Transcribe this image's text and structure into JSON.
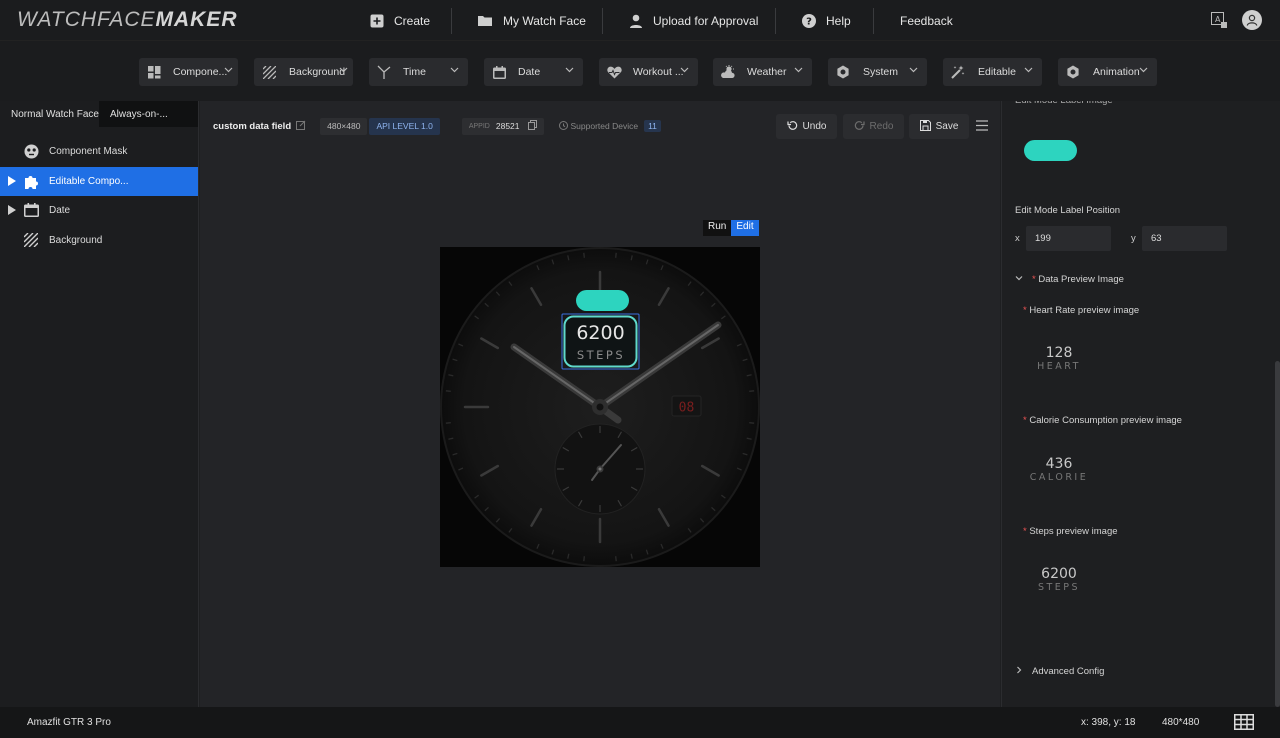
{
  "app": {
    "logo_light": "WATCHFACE",
    "logo_bold": "MAKER"
  },
  "topnav": [
    {
      "label": "Create",
      "icon": "plus-square-icon"
    },
    {
      "label": "My Watch Face",
      "icon": "folder-icon"
    },
    {
      "label": "Upload for Approval",
      "icon": "user-icon"
    },
    {
      "label": "Help",
      "icon": "help-circle-icon"
    },
    {
      "label": "Feedback"
    }
  ],
  "toolbar": [
    {
      "label": "Compone...",
      "icon": "grid-icon"
    },
    {
      "label": "Background",
      "icon": "hatch-icon"
    },
    {
      "label": "Time",
      "icon": "clock-hands-icon"
    },
    {
      "label": "Date",
      "icon": "calendar-icon"
    },
    {
      "label": "Workout ...",
      "icon": "heart-icon"
    },
    {
      "label": "Weather",
      "icon": "cloud-sun-icon"
    },
    {
      "label": "System",
      "icon": "hexagon-icon"
    },
    {
      "label": "Editable",
      "icon": "wand-icon"
    },
    {
      "label": "Animation",
      "icon": "hexagon-icon"
    }
  ],
  "left": {
    "tabs": [
      "Normal Watch Face",
      "Always-on-..."
    ],
    "tree": [
      {
        "label": "Component Mask",
        "icon": "mask-icon",
        "expandable": false,
        "selected": false
      },
      {
        "label": "Editable Compo...",
        "icon": "puzzle-icon",
        "expandable": true,
        "selected": true
      },
      {
        "label": "Date",
        "icon": "calendar-icon",
        "expandable": true,
        "selected": false
      },
      {
        "label": "Background",
        "icon": "hatch-icon",
        "expandable": false,
        "selected": false
      }
    ]
  },
  "center": {
    "field_name": "custom data field",
    "resolution": "480×480",
    "api_level": "API LEVEL 1.0",
    "appid_label": "APPID",
    "appid": "28521",
    "supported_label": "Supported Device",
    "supported_count": "11",
    "undo": "Undo",
    "redo": "Redo",
    "save": "Save",
    "run": "Run",
    "edit": "Edit"
  },
  "watch": {
    "steps_value": "6200",
    "steps_unit": "STEPS",
    "date_value": "08",
    "accent": "#2dd4bf"
  },
  "right": {
    "cut_label": "Edit Mode Label Image",
    "position_label": "Edit Mode Label Position",
    "x_label": "x",
    "x_value": "199",
    "y_label": "y",
    "y_value": "63",
    "section_title": "Data Preview Image",
    "previews": [
      {
        "label": "Heart Rate preview image",
        "value": "128",
        "unit": "HEART"
      },
      {
        "label": "Calorie Consumption preview image",
        "value": "436",
        "unit": "CALORIE"
      },
      {
        "label": "Steps preview image",
        "value": "6200",
        "unit": "STEPS"
      }
    ],
    "advanced": "Advanced Config"
  },
  "status": {
    "device": "Amazfit GTR 3 Pro",
    "coords": "x: 398, y: 18",
    "size": "480*480"
  }
}
